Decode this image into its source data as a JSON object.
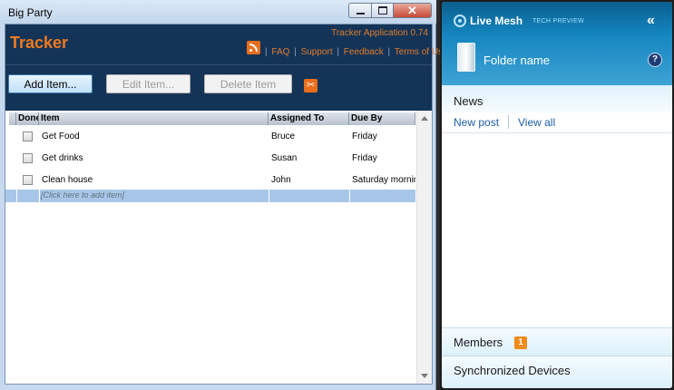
{
  "window": {
    "title": "Big Party",
    "controls": {
      "minimize": "minimize-icon",
      "maximize": "maximize-icon",
      "close": "✕"
    }
  },
  "app": {
    "brand": "Tracker",
    "version": "Tracker Application 0.74",
    "links": [
      "FAQ",
      "Support",
      "Feedback",
      "Terms of Use"
    ],
    "toolbar": {
      "add_label": "Add Item...",
      "edit_label": "Edit Item...",
      "delete_label": "Delete Item"
    },
    "grid": {
      "columns": [
        "Done",
        "Item",
        "Assigned To",
        "Due By"
      ],
      "rows": [
        {
          "done": false,
          "item": "Get Food",
          "assigned": "Bruce",
          "due": "Friday"
        },
        {
          "done": false,
          "item": "Get drinks",
          "assigned": "Susan",
          "due": "Friday"
        },
        {
          "done": false,
          "item": "Clean house",
          "assigned": "John",
          "due": "Saturday mornin"
        }
      ],
      "new_row_placeholder": "[Click here to add item]"
    }
  },
  "mesh": {
    "brand": "Live Mesh",
    "tag": "TECH PREVIEW",
    "collapse": "«",
    "folder_name": "Folder name",
    "help": "?",
    "news": {
      "title": "News",
      "new_post": "New post",
      "view_all": "View all"
    },
    "members": {
      "label": "Members",
      "count": "1"
    },
    "sync": {
      "label": "Synchronized Devices"
    }
  }
}
